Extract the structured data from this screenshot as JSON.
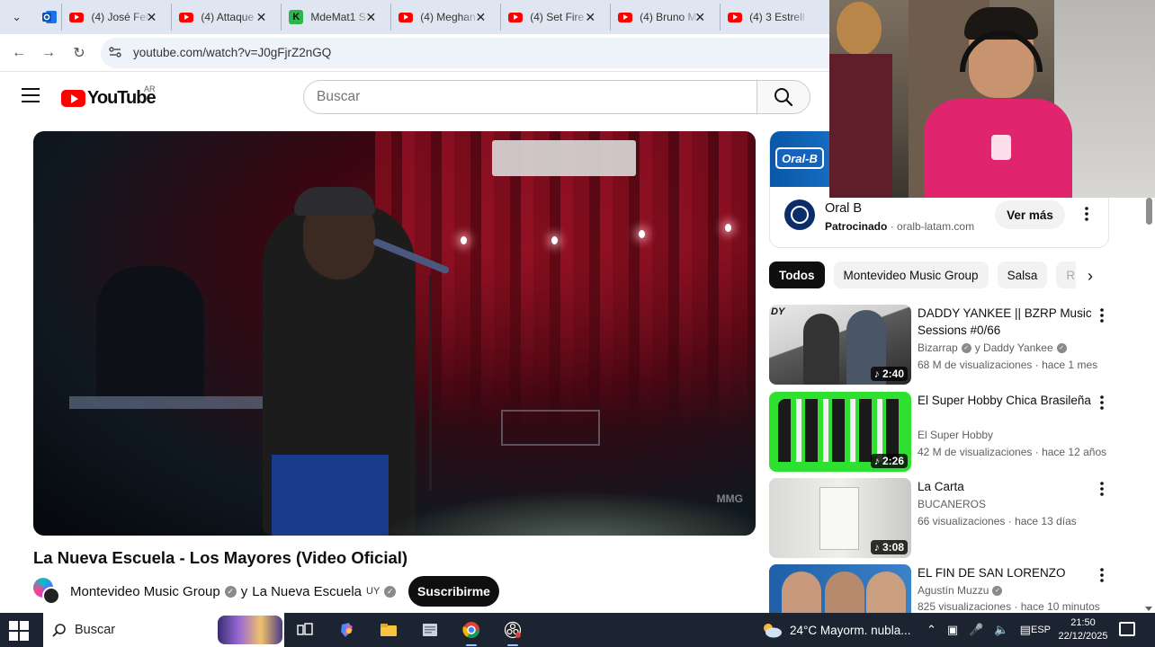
{
  "browser": {
    "tabs": [
      {
        "title": "(4) José Feli",
        "favicon": "youtube"
      },
      {
        "title": "(4) Attaque",
        "favicon": "youtube"
      },
      {
        "title": "MdeMat1 S",
        "favicon": "kick"
      },
      {
        "title": "(4) Meghan",
        "favicon": "youtube"
      },
      {
        "title": "(4) Set Fire",
        "favicon": "youtube"
      },
      {
        "title": "(4) Bruno M",
        "favicon": "youtube"
      },
      {
        "title": "(4) 3 Estrell",
        "favicon": "youtube"
      }
    ],
    "url": "youtube.com/watch?v=J0gFjrZ2nGQ"
  },
  "youtube": {
    "logo_text": "YouTube",
    "country": "AR",
    "search_placeholder": "Buscar",
    "video": {
      "title": "La Nueva Escuela - Los Mayores (Video Oficial)",
      "channel": "Montevideo Music Group",
      "collab_prefix": "y",
      "collab_channel": "La Nueva Escuela",
      "collab_country": "UY",
      "subscribe_label": "Suscribirme",
      "watermark": "MMG"
    },
    "ad": {
      "brand_badge": "Oral-B",
      "title": "Oral B",
      "sponsored": "Patrocinado",
      "domain": "oralb-latam.com",
      "cta": "Ver más"
    },
    "chips": [
      "Todos",
      "Montevideo Music Group",
      "Salsa",
      "R"
    ],
    "recommendations": [
      {
        "title": "DADDY YANKEE || BZRP Music Sessions #0/66",
        "channel": "Bizarrap",
        "channel_extra": "y Daddy Yankee",
        "views": "68 M de visualizaciones",
        "age": "hace 1 mes",
        "duration": "2:40",
        "thumb_label": "DY"
      },
      {
        "title": "El Super Hobby   Chica Brasileña",
        "channel": "El Super Hobby",
        "channel_extra": "",
        "views": "42 M de visualizaciones",
        "age": "hace 12 años",
        "duration": "2:26",
        "thumb_label": ""
      },
      {
        "title": "La Carta",
        "channel": "BUCANEROS",
        "channel_extra": "",
        "views": "66 visualizaciones",
        "age": "hace 13 días",
        "duration": "3:08",
        "thumb_label": ""
      },
      {
        "title": "EL FIN DE SAN LORENZO",
        "channel": "Agustín Muzzu",
        "channel_extra": "",
        "views": "825 visualizaciones",
        "age": "hace 10 minutos",
        "duration": "",
        "thumb_label": ""
      }
    ]
  },
  "taskbar": {
    "search_label": "Buscar",
    "weather": "24°C  Mayorm. nubla...",
    "language": "ESP",
    "time": "21:50",
    "date": "22/12/2025"
  },
  "colors": {
    "youtube_red": "#ff0000",
    "chip_active": "#0f0f0f",
    "subscribe_bg": "#0f0f0f",
    "taskbar_bg": "#1b2430"
  }
}
